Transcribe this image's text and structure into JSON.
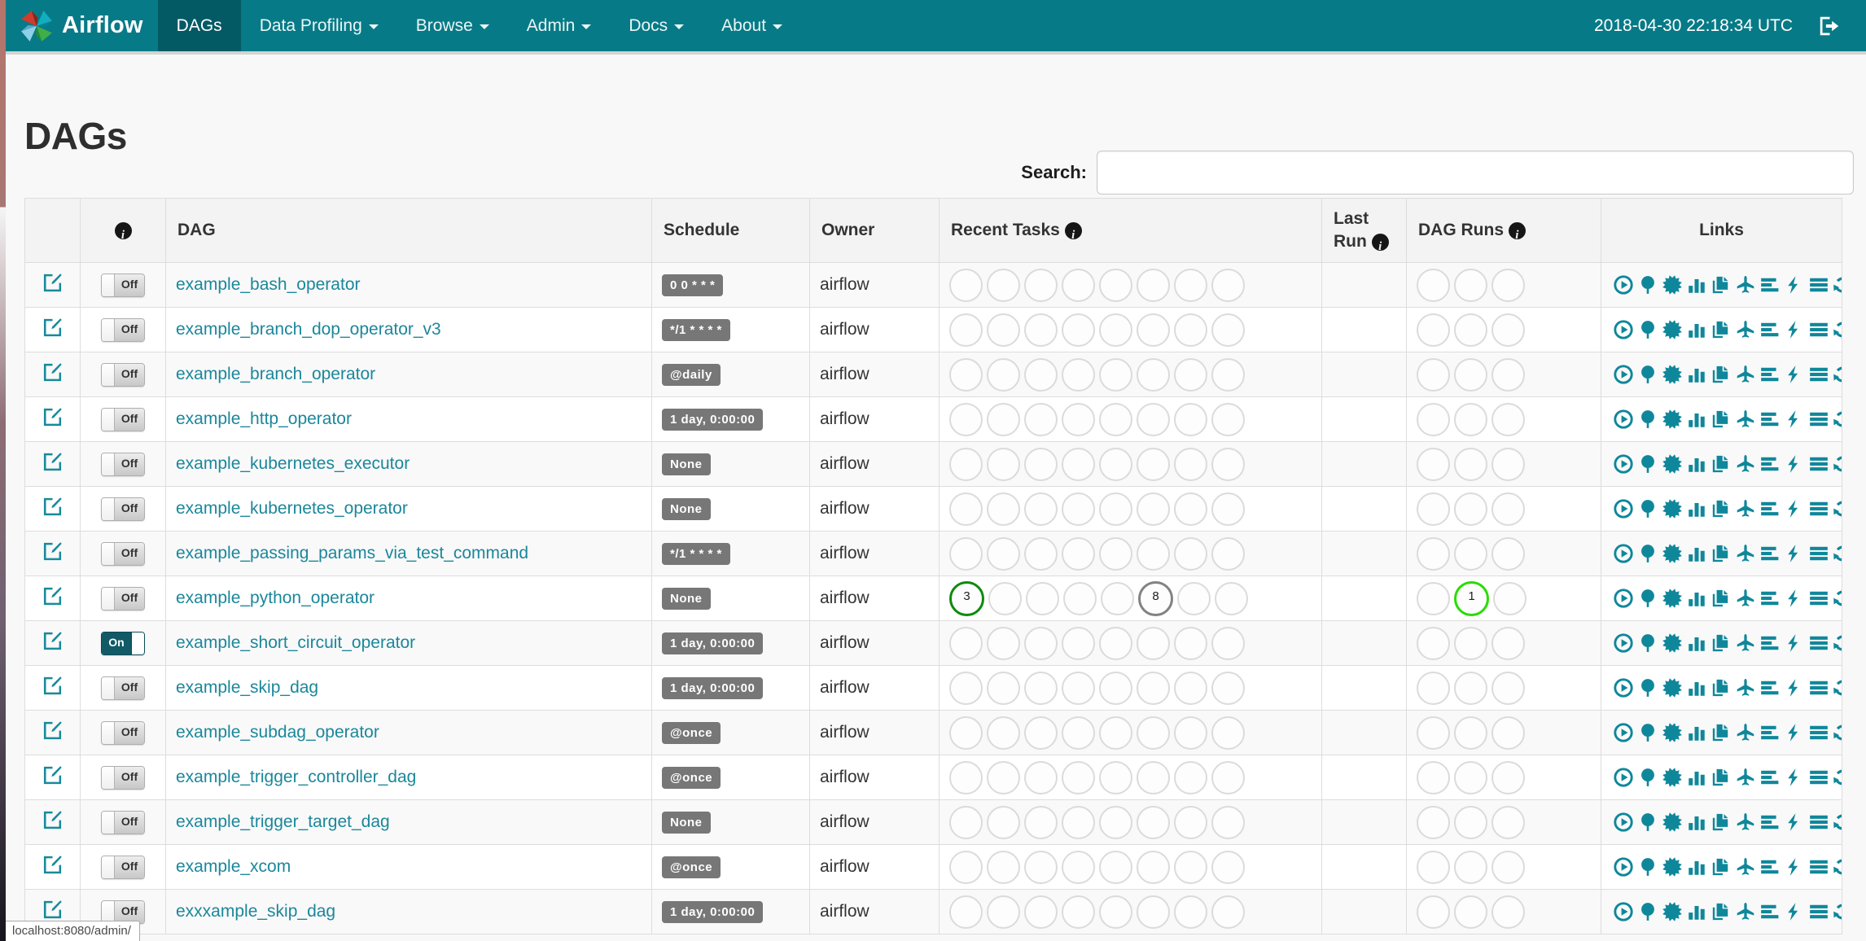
{
  "colors": {
    "navbar": "#077a87",
    "navbar_active": "#045a64",
    "accent_teal": "#0f879b",
    "badge_gray": "#777777",
    "state_success": "#0e8a0e",
    "state_queued": "#828282",
    "state_running": "#27dd00"
  },
  "navbar": {
    "brand": "Airflow",
    "clock": "2018-04-30 22:18:34 UTC",
    "logout_icon": "sign-out-icon",
    "items": [
      {
        "label": "DAGs",
        "active": true,
        "caret": false
      },
      {
        "label": "Data Profiling",
        "active": false,
        "caret": true
      },
      {
        "label": "Browse",
        "active": false,
        "caret": true
      },
      {
        "label": "Admin",
        "active": false,
        "caret": true
      },
      {
        "label": "Docs",
        "active": false,
        "caret": true
      },
      {
        "label": "About",
        "active": false,
        "caret": true
      }
    ]
  },
  "page": {
    "title": "DAGs",
    "search_label": "Search:",
    "search_value": "",
    "status_tooltip": "localhost:8080/admin/"
  },
  "table": {
    "headers": {
      "dag": "DAG",
      "schedule": "Schedule",
      "owner": "Owner",
      "recent_tasks": "Recent Tasks",
      "last_run": "Last Run",
      "dag_runs": "DAG Runs",
      "links": "Links"
    },
    "toggle_on_label": "On",
    "toggle_off_label": "Off",
    "recent_task_slots": 8,
    "dag_run_slots": 3,
    "link_icons": [
      "trigger-dag",
      "tree-view",
      "graph-view",
      "task-duration",
      "task-tries",
      "landing-times",
      "gantt",
      "code",
      "logs",
      "refresh"
    ],
    "rows": [
      {
        "dag_id": "example_bash_operator",
        "enabled": false,
        "schedule": "0 0 * * *",
        "owner": "airflow",
        "last_run": "",
        "recent_tasks": [],
        "dag_runs": []
      },
      {
        "dag_id": "example_branch_dop_operator_v3",
        "enabled": false,
        "schedule": "*/1 * * * *",
        "owner": "airflow",
        "last_run": "",
        "recent_tasks": [],
        "dag_runs": []
      },
      {
        "dag_id": "example_branch_operator",
        "enabled": false,
        "schedule": "@daily",
        "owner": "airflow",
        "last_run": "",
        "recent_tasks": [],
        "dag_runs": []
      },
      {
        "dag_id": "example_http_operator",
        "enabled": false,
        "schedule": "1 day, 0:00:00",
        "owner": "airflow",
        "last_run": "",
        "recent_tasks": [],
        "dag_runs": []
      },
      {
        "dag_id": "example_kubernetes_executor",
        "enabled": false,
        "schedule": "None",
        "owner": "airflow",
        "last_run": "",
        "recent_tasks": [],
        "dag_runs": []
      },
      {
        "dag_id": "example_kubernetes_operator",
        "enabled": false,
        "schedule": "None",
        "owner": "airflow",
        "last_run": "",
        "recent_tasks": [],
        "dag_runs": []
      },
      {
        "dag_id": "example_passing_params_via_test_command",
        "enabled": false,
        "schedule": "*/1 * * * *",
        "owner": "airflow",
        "last_run": "",
        "recent_tasks": [],
        "dag_runs": []
      },
      {
        "dag_id": "example_python_operator",
        "enabled": false,
        "schedule": "None",
        "owner": "airflow",
        "last_run": "",
        "recent_tasks": [
          {
            "slot": 1,
            "count": 3,
            "state": "success"
          },
          {
            "slot": 6,
            "count": 8,
            "state": "queued"
          }
        ],
        "dag_runs": [
          {
            "slot": 2,
            "count": 1,
            "state": "running"
          }
        ]
      },
      {
        "dag_id": "example_short_circuit_operator",
        "enabled": true,
        "schedule": "1 day, 0:00:00",
        "owner": "airflow",
        "last_run": "",
        "recent_tasks": [],
        "dag_runs": []
      },
      {
        "dag_id": "example_skip_dag",
        "enabled": false,
        "schedule": "1 day, 0:00:00",
        "owner": "airflow",
        "last_run": "",
        "recent_tasks": [],
        "dag_runs": []
      },
      {
        "dag_id": "example_subdag_operator",
        "enabled": false,
        "schedule": "@once",
        "owner": "airflow",
        "last_run": "",
        "recent_tasks": [],
        "dag_runs": []
      },
      {
        "dag_id": "example_trigger_controller_dag",
        "enabled": false,
        "schedule": "@once",
        "owner": "airflow",
        "last_run": "",
        "recent_tasks": [],
        "dag_runs": []
      },
      {
        "dag_id": "example_trigger_target_dag",
        "enabled": false,
        "schedule": "None",
        "owner": "airflow",
        "last_run": "",
        "recent_tasks": [],
        "dag_runs": []
      },
      {
        "dag_id": "example_xcom",
        "enabled": false,
        "schedule": "@once",
        "owner": "airflow",
        "last_run": "",
        "recent_tasks": [],
        "dag_runs": []
      },
      {
        "dag_id": "exxxample_skip_dag",
        "enabled": false,
        "schedule": "1 day, 0:00:00",
        "owner": "airflow",
        "last_run": "",
        "recent_tasks": [],
        "dag_runs": []
      }
    ]
  }
}
